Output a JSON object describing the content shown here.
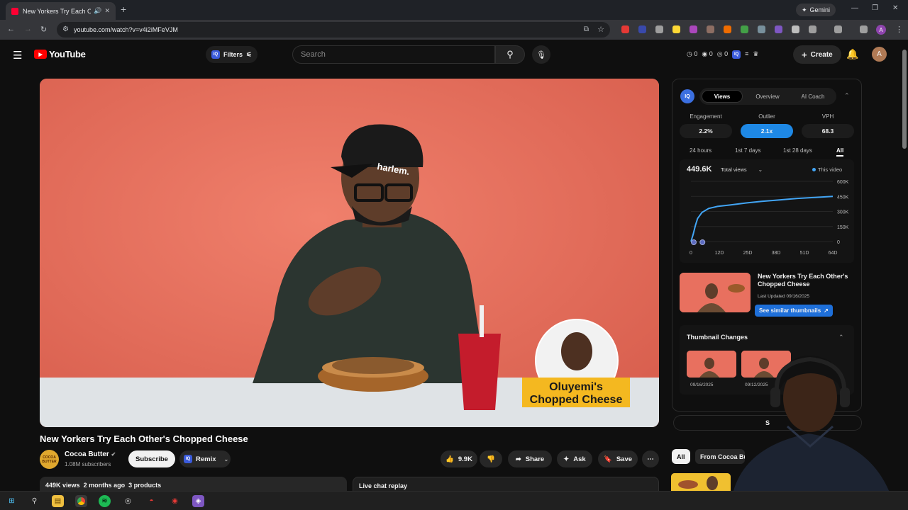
{
  "browser": {
    "tab_title": "New Yorkers Try Each Othe",
    "url": "youtube.com/watch?v=v4i2iMFeVJM",
    "gemini_label": "Gemini",
    "profile_initial": "A"
  },
  "yt": {
    "logo_text": "YouTube",
    "filters_label": "Filters",
    "search_placeholder": "Search",
    "header_stats": [
      "0",
      "0",
      "0"
    ],
    "create_label": "Create",
    "avatar_initial": "A"
  },
  "video": {
    "overlay_line1": "Oluyemi's",
    "overlay_line2": "Chopped Cheese",
    "cap_text": "harlem.",
    "title": "New Yorkers Try Each Other's Chopped Cheese",
    "channel_name": "Cocoa Butter",
    "channel_avatar_text": "COCOA BUTTER",
    "subscribers": "1.08M subscribers",
    "subscribe_label": "Subscribe",
    "remix_label": "Remix",
    "likes": "9.9K",
    "share_label": "Share",
    "ask_label": "Ask",
    "save_label": "Save",
    "views": "449K views",
    "age": "2 months ago",
    "products": "3 products",
    "live_chat": "Live chat replay"
  },
  "iq_panel": {
    "logo": "IQ",
    "tabs": [
      "Views",
      "Overview",
      "AI Coach"
    ],
    "active_tab": "Views",
    "metrics": [
      {
        "label": "Engagement",
        "value": "2.2%"
      },
      {
        "label": "Outlier",
        "value": "2.1x"
      },
      {
        "label": "VPH",
        "value": "68.3"
      }
    ],
    "ranges": [
      "24 hours",
      "1st 7 days",
      "1st 28 days",
      "All"
    ],
    "active_range": "All",
    "total_views": "449.6K",
    "total_views_select": "Total views",
    "legend": "This video",
    "card_title": "New Yorkers Try Each Other's Chopped Cheese",
    "card_updated": "Last Updated 09/16/2025",
    "similar_btn": "See similar thumbnails",
    "thumb_changes_title": "Thumbnail Changes",
    "thumb_dates": [
      "09/16/2025",
      "09/12/2025"
    ]
  },
  "chart_data": {
    "type": "line",
    "series": [
      {
        "x": [
          0,
          1,
          2,
          3,
          5,
          8,
          12,
          18,
          25,
          32,
          40,
          48,
          56,
          64
        ],
        "values": [
          0,
          70000,
          160000,
          230000,
          290000,
          330000,
          350000,
          365000,
          385000,
          400000,
          415000,
          430000,
          440000,
          450000
        ]
      }
    ],
    "x_ticks": [
      "0",
      "12D",
      "25D",
      "38D",
      "51D",
      "64D"
    ],
    "y_ticks": [
      "600K",
      "450K",
      "300K",
      "150K",
      "0"
    ],
    "ylim": [
      0,
      600000
    ],
    "xlim": [
      0,
      64
    ],
    "color": "#42a5f5"
  },
  "right_col": {
    "shorts_label": "S",
    "chip_all": "All",
    "chip_from": "From Cocoa Butter"
  }
}
